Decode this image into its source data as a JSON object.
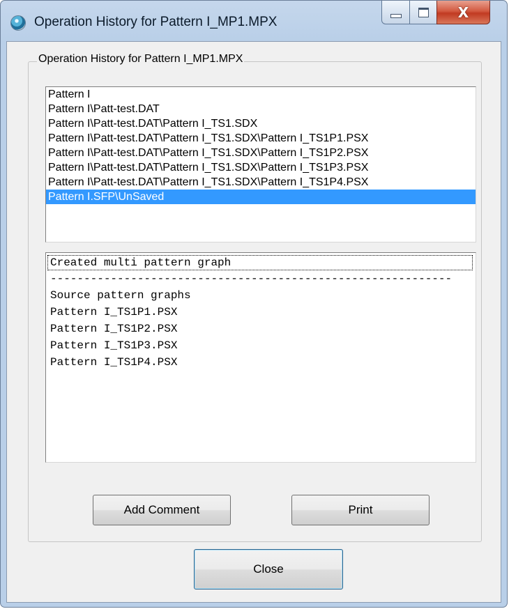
{
  "window": {
    "title": "Operation History for Pattern I_MP1.MPX",
    "icon": "globe-app-icon"
  },
  "title_buttons": {
    "minimize": "minimize-icon",
    "maximize": "maximize-icon",
    "close": "close-icon",
    "close_glyph": "X"
  },
  "group": {
    "label": "Operation History for Pattern I_MP1.MPX"
  },
  "history_list": {
    "items": [
      "Pattern I",
      "Pattern I\\Patt-test.DAT",
      "Pattern I\\Patt-test.DAT\\Pattern I_TS1.SDX",
      "Pattern I\\Patt-test.DAT\\Pattern I_TS1.SDX\\Pattern I_TS1P1.PSX",
      "Pattern I\\Patt-test.DAT\\Pattern I_TS1.SDX\\Pattern I_TS1P2.PSX",
      "Pattern I\\Patt-test.DAT\\Pattern I_TS1.SDX\\Pattern I_TS1P3.PSX",
      "Pattern I\\Patt-test.DAT\\Pattern I_TS1.SDX\\Pattern I_TS1P4.PSX",
      "Pattern I.SFP\\UnSaved"
    ],
    "selected_index": 7
  },
  "detail_text": {
    "lines": [
      "Created multi pattern graph",
      "------------------------------------------------------------",
      "Source pattern graphs",
      "Pattern I_TS1P1.PSX",
      "Pattern I_TS1P2.PSX",
      "Pattern I_TS1P3.PSX",
      "Pattern I_TS1P4.PSX"
    ]
  },
  "buttons": {
    "add_comment": "Add Comment",
    "print": "Print",
    "close": "Close"
  },
  "colors": {
    "selection": "#3399ff",
    "title_close": "#c13a22"
  }
}
